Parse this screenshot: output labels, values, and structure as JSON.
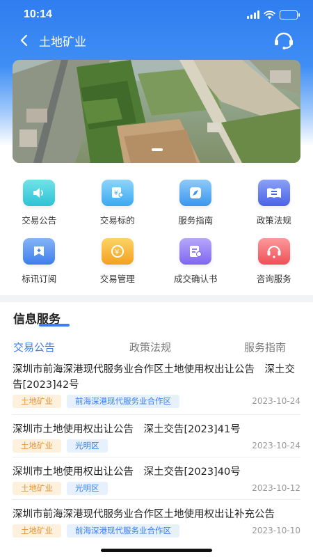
{
  "status_bar": {
    "time": "10:14"
  },
  "nav": {
    "title": "土地矿业"
  },
  "banner": {
    "alt": "land aerial photo",
    "active_slide": 1
  },
  "menu": [
    {
      "label": "交易公告",
      "icon": "speaker-icon",
      "color_top": "#6fe3e6",
      "color_bottom": "#2fc2d6"
    },
    {
      "label": "交易标的",
      "icon": "certificate-icon",
      "color_top": "#8fd4fb",
      "color_bottom": "#3aa9f0"
    },
    {
      "label": "服务指南",
      "icon": "compass-icon",
      "color_top": "#8ecaf8",
      "color_bottom": "#3a96ee"
    },
    {
      "label": "政策法规",
      "icon": "book-icon",
      "color_top": "#8ba1f6",
      "color_bottom": "#4a62e6"
    },
    {
      "label": "标讯订阅",
      "icon": "subscribe-icon",
      "color_top": "#84b5f8",
      "color_bottom": "#3f7deb"
    },
    {
      "label": "交易管理",
      "icon": "yen-cycle-icon",
      "color_top": "#fcd465",
      "color_bottom": "#f4a021"
    },
    {
      "label": "成交确认书",
      "icon": "confirm-doc-icon",
      "color_top": "#b6a8f9",
      "color_bottom": "#7e66f0"
    },
    {
      "label": "咨询服务",
      "icon": "headset-icon",
      "color_top": "#fb9a9c",
      "color_bottom": "#ef4f57"
    }
  ],
  "info": {
    "section_title": "信息服务",
    "tabs": [
      "交易公告",
      "政策法规",
      "服务指南"
    ],
    "active_tab": 0
  },
  "news": [
    {
      "title": "深圳市前海深港现代服务业合作区土地使用权出让公告　深土交告[2023]42号",
      "tags": [
        "土地矿业",
        "前海深港现代服务业合作区"
      ],
      "date": "2023-10-24"
    },
    {
      "title": "深圳市土地使用权出让公告　深土交告[2023]41号",
      "tags": [
        "土地矿业",
        "光明区"
      ],
      "date": "2023-10-24"
    },
    {
      "title": "深圳市土地使用权出让公告　深土交告[2023]40号",
      "tags": [
        "土地矿业",
        "光明区"
      ],
      "date": "2023-10-12"
    },
    {
      "title": "深圳市前海深港现代服务业合作区土地使用权出让补充公告",
      "tags": [
        "土地矿业",
        "前海深港现代服务业合作区"
      ],
      "date": "2023-10-10"
    }
  ],
  "colors": {
    "primary": "#3b7ff0",
    "tag_orange": "#e4953a",
    "tag_blue": "#3b7ff0"
  }
}
